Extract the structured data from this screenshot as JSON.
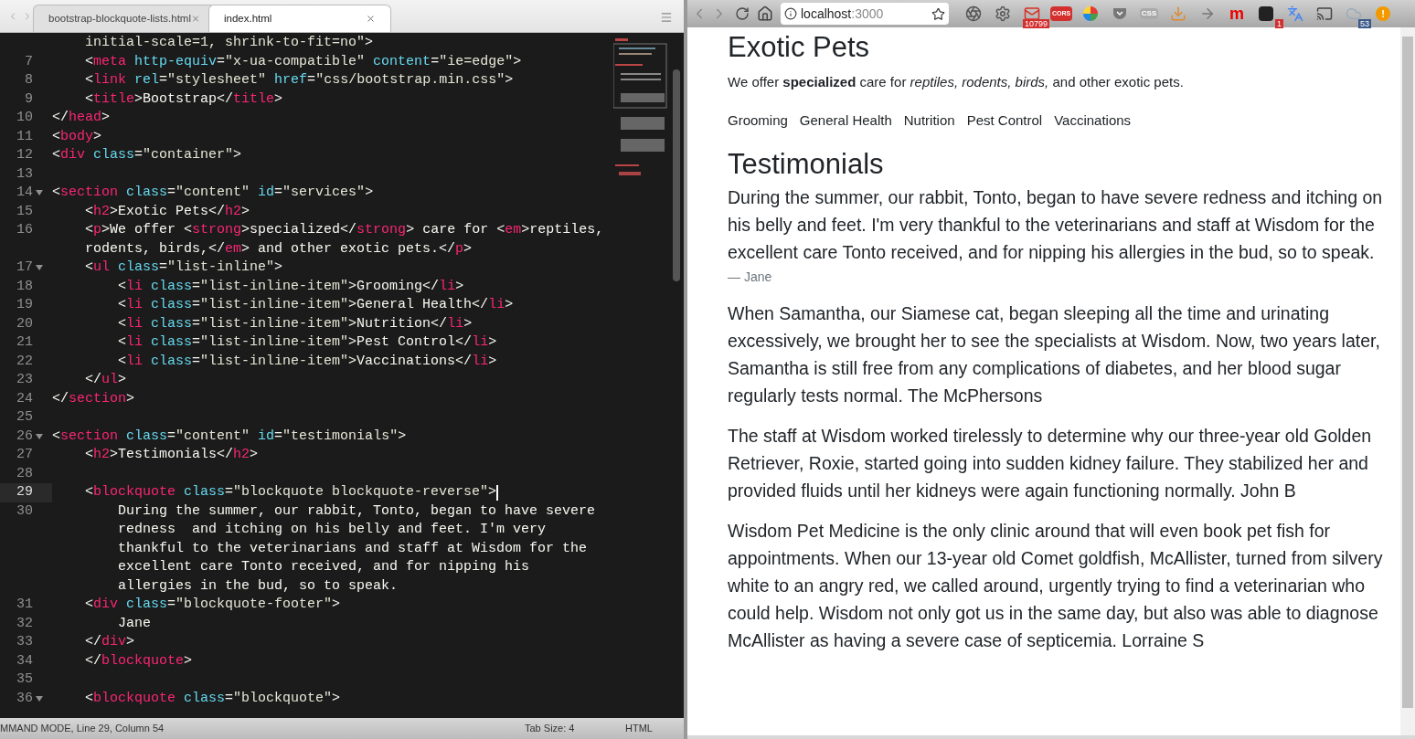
{
  "editor": {
    "tabs": [
      {
        "label": "bootstrap-blockquote-lists.html",
        "selected": false
      },
      {
        "label": "index.html",
        "selected": true
      }
    ],
    "lines": [
      {
        "rows": [
          {
            "tokens": [
              {
                "kind": "string",
                "text": "    initial-scale=1, shrink-to-fit=no\""
              },
              {
                "kind": "plain",
                "text": ">"
              }
            ]
          }
        ],
        "current": false,
        "fold": false
      },
      {
        "number": "7",
        "rows": [
          {
            "tokens": [
              {
                "kind": "plain",
                "text": "    <"
              },
              {
                "kind": "tag",
                "text": "meta"
              },
              {
                "kind": "attr",
                "text": " http-equiv"
              },
              {
                "kind": "plain",
                "text": "="
              },
              {
                "kind": "string",
                "text": "\"x-ua-compatible\""
              },
              {
                "kind": "attr",
                "text": " content"
              },
              {
                "kind": "plain",
                "text": "="
              },
              {
                "kind": "string",
                "text": "\"ie=edge\""
              },
              {
                "kind": "plain",
                "text": ">"
              }
            ]
          }
        ],
        "current": false,
        "fold": false
      },
      {
        "number": "8",
        "rows": [
          {
            "tokens": [
              {
                "kind": "plain",
                "text": "    <"
              },
              {
                "kind": "tag",
                "text": "link"
              },
              {
                "kind": "attr",
                "text": " rel"
              },
              {
                "kind": "plain",
                "text": "="
              },
              {
                "kind": "string",
                "text": "\"stylesheet\""
              },
              {
                "kind": "attr",
                "text": " href"
              },
              {
                "kind": "plain",
                "text": "="
              },
              {
                "kind": "string",
                "text": "\"css/bootstrap.min.css\""
              },
              {
                "kind": "plain",
                "text": ">"
              }
            ]
          }
        ],
        "current": false,
        "fold": false
      },
      {
        "number": "9",
        "rows": [
          {
            "tokens": [
              {
                "kind": "plain",
                "text": "    <"
              },
              {
                "kind": "tag",
                "text": "title"
              },
              {
                "kind": "plain",
                "text": ">Bootstrap</"
              },
              {
                "kind": "tag",
                "text": "title"
              },
              {
                "kind": "plain",
                "text": ">"
              }
            ]
          }
        ],
        "current": false,
        "fold": false
      },
      {
        "number": "10",
        "rows": [
          {
            "tokens": [
              {
                "kind": "plain",
                "text": "</"
              },
              {
                "kind": "tag",
                "text": "head"
              },
              {
                "kind": "plain",
                "text": ">"
              }
            ]
          }
        ],
        "current": false,
        "fold": false
      },
      {
        "number": "11",
        "rows": [
          {
            "tokens": [
              {
                "kind": "plain",
                "text": "<"
              },
              {
                "kind": "tag",
                "text": "body"
              },
              {
                "kind": "plain",
                "text": ">"
              }
            ]
          }
        ],
        "current": false,
        "fold": false
      },
      {
        "number": "12",
        "rows": [
          {
            "tokens": [
              {
                "kind": "plain",
                "text": "<"
              },
              {
                "kind": "tag",
                "text": "div"
              },
              {
                "kind": "attr",
                "text": " class"
              },
              {
                "kind": "plain",
                "text": "="
              },
              {
                "kind": "string",
                "text": "\"container\""
              },
              {
                "kind": "plain",
                "text": ">"
              }
            ]
          }
        ],
        "current": false,
        "fold": false
      },
      {
        "number": "13",
        "current": false,
        "fold": false
      },
      {
        "number": "14",
        "rows": [
          {
            "tokens": [
              {
                "kind": "plain",
                "text": "<"
              },
              {
                "kind": "tag",
                "text": "section"
              },
              {
                "kind": "attr",
                "text": " class"
              },
              {
                "kind": "plain",
                "text": "="
              },
              {
                "kind": "string",
                "text": "\"content\""
              },
              {
                "kind": "attr",
                "text": " id"
              },
              {
                "kind": "plain",
                "text": "="
              },
              {
                "kind": "string",
                "text": "\"services\""
              },
              {
                "kind": "plain",
                "text": ">"
              }
            ]
          }
        ],
        "current": false,
        "fold": true
      },
      {
        "number": "15",
        "rows": [
          {
            "tokens": [
              {
                "kind": "plain",
                "text": "    <"
              },
              {
                "kind": "tag",
                "text": "h2"
              },
              {
                "kind": "plain",
                "text": ">Exotic Pets</"
              },
              {
                "kind": "tag",
                "text": "h2"
              },
              {
                "kind": "plain",
                "text": ">"
              }
            ]
          }
        ],
        "current": false,
        "fold": false
      },
      {
        "number": "16",
        "rows": [
          {
            "tokens": [
              {
                "kind": "plain",
                "text": "    <"
              },
              {
                "kind": "tag",
                "text": "p"
              },
              {
                "kind": "plain",
                "text": ">We offer <"
              },
              {
                "kind": "tag",
                "text": "strong"
              },
              {
                "kind": "plain",
                "text": ">specialized</"
              },
              {
                "kind": "tag",
                "text": "strong"
              },
              {
                "kind": "plain",
                "text": "> care for <"
              },
              {
                "kind": "tag",
                "text": "em"
              },
              {
                "kind": "plain",
                "text": ">reptiles,"
              }
            ]
          },
          {
            "tokens": [
              {
                "kind": "plain",
                "text": "    rodents, birds,</"
              },
              {
                "kind": "tag",
                "text": "em"
              },
              {
                "kind": "plain",
                "text": "> and other exotic pets.</"
              },
              {
                "kind": "tag",
                "text": "p"
              },
              {
                "kind": "plain",
                "text": ">"
              }
            ]
          }
        ],
        "current": false,
        "fold": false
      },
      {
        "number": "17",
        "rows": [
          {
            "tokens": [
              {
                "kind": "plain",
                "text": "    <"
              },
              {
                "kind": "tag",
                "text": "ul"
              },
              {
                "kind": "attr",
                "text": " class"
              },
              {
                "kind": "plain",
                "text": "="
              },
              {
                "kind": "string",
                "text": "\"list-inline\""
              },
              {
                "kind": "plain",
                "text": ">"
              }
            ]
          }
        ],
        "current": false,
        "fold": true
      },
      {
        "number": "18",
        "rows": [
          {
            "tokens": [
              {
                "kind": "plain",
                "text": "        <"
              },
              {
                "kind": "tag",
                "text": "li"
              },
              {
                "kind": "attr",
                "text": " class"
              },
              {
                "kind": "plain",
                "text": "="
              },
              {
                "kind": "string",
                "text": "\"list-inline-item\""
              },
              {
                "kind": "plain",
                "text": ">Grooming</"
              },
              {
                "kind": "tag",
                "text": "li"
              },
              {
                "kind": "plain",
                "text": ">"
              }
            ]
          }
        ],
        "current": false,
        "fold": false
      },
      {
        "number": "19",
        "rows": [
          {
            "tokens": [
              {
                "kind": "plain",
                "text": "        <"
              },
              {
                "kind": "tag",
                "text": "li"
              },
              {
                "kind": "attr",
                "text": " class"
              },
              {
                "kind": "plain",
                "text": "="
              },
              {
                "kind": "string",
                "text": "\"list-inline-item\""
              },
              {
                "kind": "plain",
                "text": ">General Health</"
              },
              {
                "kind": "tag",
                "text": "li"
              },
              {
                "kind": "plain",
                "text": ">"
              }
            ]
          }
        ],
        "current": false,
        "fold": false
      },
      {
        "number": "20",
        "rows": [
          {
            "tokens": [
              {
                "kind": "plain",
                "text": "        <"
              },
              {
                "kind": "tag",
                "text": "li"
              },
              {
                "kind": "attr",
                "text": " class"
              },
              {
                "kind": "plain",
                "text": "="
              },
              {
                "kind": "string",
                "text": "\"list-inline-item\""
              },
              {
                "kind": "plain",
                "text": ">Nutrition</"
              },
              {
                "kind": "tag",
                "text": "li"
              },
              {
                "kind": "plain",
                "text": ">"
              }
            ]
          }
        ],
        "current": false,
        "fold": false
      },
      {
        "number": "21",
        "rows": [
          {
            "tokens": [
              {
                "kind": "plain",
                "text": "        <"
              },
              {
                "kind": "tag",
                "text": "li"
              },
              {
                "kind": "attr",
                "text": " class"
              },
              {
                "kind": "plain",
                "text": "="
              },
              {
                "kind": "string",
                "text": "\"list-inline-item\""
              },
              {
                "kind": "plain",
                "text": ">Pest Control</"
              },
              {
                "kind": "tag",
                "text": "li"
              },
              {
                "kind": "plain",
                "text": ">"
              }
            ]
          }
        ],
        "current": false,
        "fold": false
      },
      {
        "number": "22",
        "rows": [
          {
            "tokens": [
              {
                "kind": "plain",
                "text": "        <"
              },
              {
                "kind": "tag",
                "text": "li"
              },
              {
                "kind": "attr",
                "text": " class"
              },
              {
                "kind": "plain",
                "text": "="
              },
              {
                "kind": "string",
                "text": "\"list-inline-item\""
              },
              {
                "kind": "plain",
                "text": ">Vaccinations</"
              },
              {
                "kind": "tag",
                "text": "li"
              },
              {
                "kind": "plain",
                "text": ">"
              }
            ]
          }
        ],
        "current": false,
        "fold": false
      },
      {
        "number": "23",
        "rows": [
          {
            "tokens": [
              {
                "kind": "plain",
                "text": "    </"
              },
              {
                "kind": "tag",
                "text": "ul"
              },
              {
                "kind": "plain",
                "text": ">"
              }
            ]
          }
        ],
        "current": false,
        "fold": false
      },
      {
        "number": "24",
        "rows": [
          {
            "tokens": [
              {
                "kind": "plain",
                "text": "</"
              },
              {
                "kind": "tag",
                "text": "section"
              },
              {
                "kind": "plain",
                "text": ">"
              }
            ]
          }
        ],
        "current": false,
        "fold": false
      },
      {
        "number": "25",
        "current": false,
        "fold": false
      },
      {
        "number": "26",
        "rows": [
          {
            "tokens": [
              {
                "kind": "plain",
                "text": "<"
              },
              {
                "kind": "tag",
                "text": "section"
              },
              {
                "kind": "attr",
                "text": " class"
              },
              {
                "kind": "plain",
                "text": "="
              },
              {
                "kind": "string",
                "text": "\"content\""
              },
              {
                "kind": "attr",
                "text": " id"
              },
              {
                "kind": "plain",
                "text": "="
              },
              {
                "kind": "string",
                "text": "\"testimonials\""
              },
              {
                "kind": "plain",
                "text": ">"
              }
            ]
          }
        ],
        "current": false,
        "fold": true
      },
      {
        "number": "27",
        "rows": [
          {
            "tokens": [
              {
                "kind": "plain",
                "text": "    <"
              },
              {
                "kind": "tag",
                "text": "h2"
              },
              {
                "kind": "plain",
                "text": ">Testimonials</"
              },
              {
                "kind": "tag",
                "text": "h2"
              },
              {
                "kind": "plain",
                "text": ">"
              }
            ]
          }
        ],
        "current": false,
        "fold": false
      },
      {
        "number": "28",
        "current": false,
        "fold": false
      },
      {
        "number": "29",
        "rows": [
          {
            "tokens": [
              {
                "kind": "plain",
                "text": "    <"
              },
              {
                "kind": "tag",
                "text": "blockquote"
              },
              {
                "kind": "attr",
                "text": " class"
              },
              {
                "kind": "plain",
                "text": "="
              },
              {
                "kind": "string",
                "text": "\"blockquote blockquote-reverse\""
              },
              {
                "kind": "plain",
                "text": ">"
              }
            ]
          }
        ],
        "current": true,
        "fold": false
      },
      {
        "number": "30",
        "rows": [
          {
            "tokens": [
              {
                "kind": "plain",
                "text": "        During the summer, our rabbit, Tonto, began to have severe"
              }
            ]
          },
          {
            "tokens": [
              {
                "kind": "plain",
                "text": "        redness  and itching on his belly and feet. I'm very"
              }
            ]
          },
          {
            "tokens": [
              {
                "kind": "plain",
                "text": "        thankful to the veterinarians and staff at Wisdom for the"
              }
            ]
          },
          {
            "tokens": [
              {
                "kind": "plain",
                "text": "        excellent care Tonto received, and for nipping his"
              }
            ]
          },
          {
            "tokens": [
              {
                "kind": "plain",
                "text": "        allergies in the bud, so to speak."
              }
            ]
          }
        ],
        "current": false,
        "fold": false
      },
      {
        "number": "31",
        "rows": [
          {
            "tokens": [
              {
                "kind": "plain",
                "text": "    <"
              },
              {
                "kind": "tag",
                "text": "div"
              },
              {
                "kind": "attr",
                "text": " class"
              },
              {
                "kind": "plain",
                "text": "="
              },
              {
                "kind": "string",
                "text": "\"blockquote-footer\""
              },
              {
                "kind": "plain",
                "text": ">"
              }
            ]
          }
        ],
        "current": false,
        "fold": false
      },
      {
        "number": "32",
        "rows": [
          {
            "tokens": [
              {
                "kind": "plain",
                "text": "        Jane"
              }
            ]
          }
        ],
        "current": false,
        "fold": false
      },
      {
        "number": "33",
        "rows": [
          {
            "tokens": [
              {
                "kind": "plain",
                "text": "    </"
              },
              {
                "kind": "tag",
                "text": "div"
              },
              {
                "kind": "plain",
                "text": ">"
              }
            ]
          }
        ],
        "current": false,
        "fold": false
      },
      {
        "number": "34",
        "rows": [
          {
            "tokens": [
              {
                "kind": "plain",
                "text": "    </"
              },
              {
                "kind": "tag",
                "text": "blockquote"
              },
              {
                "kind": "plain",
                "text": ">"
              }
            ]
          }
        ],
        "current": false,
        "fold": false
      },
      {
        "number": "35",
        "current": false,
        "fold": false
      },
      {
        "number": "36",
        "rows": [
          {
            "tokens": [
              {
                "kind": "plain",
                "text": "    <"
              },
              {
                "kind": "tag",
                "text": "blockquote"
              },
              {
                "kind": "attr",
                "text": " class"
              },
              {
                "kind": "plain",
                "text": "="
              },
              {
                "kind": "string",
                "text": "\"blockquote\""
              },
              {
                "kind": "plain",
                "text": ">"
              }
            ]
          }
        ],
        "current": false,
        "fold": true
      }
    ],
    "status_bar": {
      "mode": "MMAND MODE, Line 29, Column 54",
      "tab_size": "Tab Size: 4",
      "syntax": "HTML"
    }
  },
  "browser": {
    "url_host": "localhost",
    "url_port": ":3000",
    "extensions": [
      {
        "kind": "reel"
      },
      {
        "kind": "gear"
      },
      {
        "kind": "mail",
        "badge": "10799"
      },
      {
        "kind": "tag",
        "text": "CORS"
      },
      {
        "kind": "wheel"
      },
      {
        "kind": "pocket"
      },
      {
        "kind": "grey-tag",
        "text": "CSS"
      },
      {
        "kind": "download"
      },
      {
        "kind": "arrow"
      },
      {
        "kind": "letter",
        "text": "m"
      },
      {
        "kind": "square",
        "badge": "1"
      },
      {
        "kind": "translate"
      },
      {
        "kind": "cast"
      },
      {
        "kind": "cloud",
        "badge": "53"
      },
      {
        "kind": "alert",
        "text": "!"
      }
    ],
    "page": {
      "title": "Exotic Pets",
      "intro": "We offer **specialized** care for *reptiles, rodents, birds,* and other exotic pets.",
      "services": [
        "Grooming",
        "General Health",
        "Nutrition",
        "Pest Control",
        "Vaccinations"
      ],
      "testimonials_heading": "Testimonials",
      "testimonials": [
        {
          "text": "During the summer, our rabbit, Tonto, began to have severe redness and itching on his belly and feet. I'm very thankful to the veterinarians and staff at Wisdom for the excellent care Tonto received, and for nipping his allergies in the bud, so to speak.",
          "footer": "— Jane"
        },
        {
          "text": "When Samantha, our Siamese cat, began sleeping all the time and urinating excessively, we brought her to see the specialists at Wisdom. Now, two years later, Samantha is still free from any complications of diabetes, and her blood sugar regularly tests normal. The McPhersons"
        },
        {
          "text": "The staff at Wisdom worked tirelessly to determine why our three-year old Golden Retriever, Roxie, started going into sudden kidney failure. They stabilized her and provided fluids until her kidneys were again functioning normally. John B"
        },
        {
          "text": "Wisdom Pet Medicine is the only clinic around that will even book pet fish for appointments. When our 13-year old Comet goldfish, McAllister, turned from silvery white to an angry red, we called around, urgently trying to find a veterinarian who could help. Wisdom not only got us in the same day, but also was able to diagnose McAllister as having a severe case of septicemia. Lorraine S"
        }
      ]
    }
  }
}
